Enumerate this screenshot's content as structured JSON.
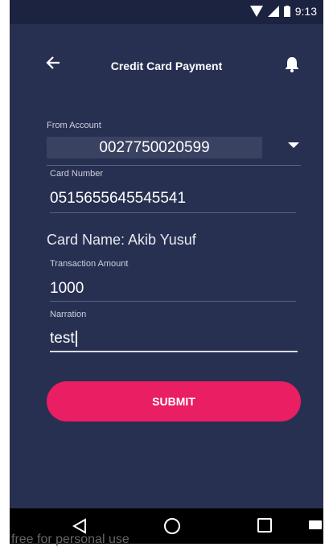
{
  "status_bar": {
    "time": "9:13"
  },
  "header": {
    "title": "Credit Card Payment"
  },
  "form": {
    "from_account_label": "From Account",
    "from_account_value": "0027750020599",
    "card_number_label": "Card Number",
    "card_number_value": "0515655645545541",
    "card_name_text": "Card Name: Akib Yusuf",
    "amount_label": "Transaction Amount",
    "amount_value": "1000",
    "narration_label": "Narration",
    "narration_value": "test"
  },
  "actions": {
    "submit_label": "SUBMIT"
  },
  "watermark": {
    "text": "free for personal use"
  },
  "colors": {
    "background": "#283052",
    "accent": "#e91e63",
    "statusbar": "#1c2340"
  }
}
